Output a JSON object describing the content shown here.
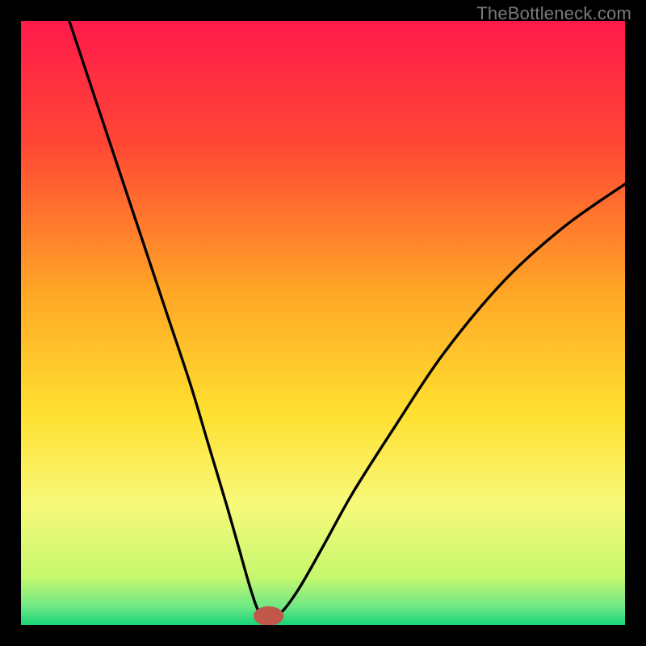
{
  "watermark": "TheBottleneck.com",
  "chart_data": {
    "type": "line",
    "title": "",
    "xlabel": "",
    "ylabel": "",
    "xlim": [
      0,
      100
    ],
    "ylim": [
      0,
      100
    ],
    "grid": false,
    "legend": false,
    "background_gradient_stops": [
      {
        "offset": 0,
        "color": "#ff1a4b"
      },
      {
        "offset": 20,
        "color": "#ff4634"
      },
      {
        "offset": 45,
        "color": "#ffa726"
      },
      {
        "offset": 65,
        "color": "#ffe030"
      },
      {
        "offset": 80,
        "color": "#f8f97a"
      },
      {
        "offset": 92,
        "color": "#c6f86e"
      },
      {
        "offset": 97,
        "color": "#6ee885"
      },
      {
        "offset": 100,
        "color": "#17d477"
      }
    ],
    "marker": {
      "x": 41,
      "y": 1.5,
      "rx": 2.5,
      "ry": 1.6,
      "color": "#c1564a"
    },
    "series": [
      {
        "name": "curve",
        "points": [
          {
            "x": 8,
            "y": 100
          },
          {
            "x": 12,
            "y": 88
          },
          {
            "x": 16,
            "y": 76
          },
          {
            "x": 20,
            "y": 64
          },
          {
            "x": 24,
            "y": 52
          },
          {
            "x": 28,
            "y": 40
          },
          {
            "x": 31,
            "y": 30
          },
          {
            "x": 34,
            "y": 20
          },
          {
            "x": 36,
            "y": 13
          },
          {
            "x": 38,
            "y": 6
          },
          {
            "x": 39.5,
            "y": 2
          },
          {
            "x": 41,
            "y": 1.5
          },
          {
            "x": 43,
            "y": 2
          },
          {
            "x": 46,
            "y": 6
          },
          {
            "x": 50,
            "y": 13
          },
          {
            "x": 55,
            "y": 22
          },
          {
            "x": 62,
            "y": 33
          },
          {
            "x": 70,
            "y": 45
          },
          {
            "x": 80,
            "y": 57
          },
          {
            "x": 90,
            "y": 66
          },
          {
            "x": 100,
            "y": 73
          }
        ]
      }
    ]
  }
}
